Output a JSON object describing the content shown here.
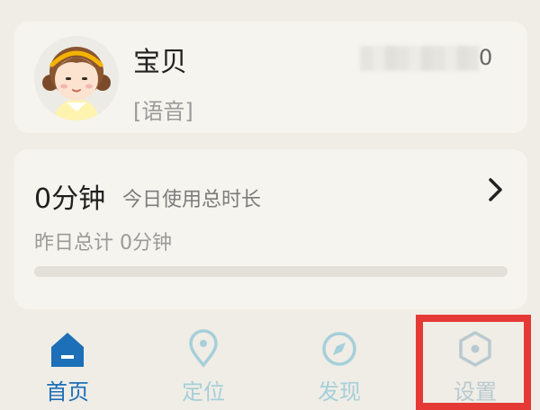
{
  "profile": {
    "name": "宝贝",
    "tag": "[语音]",
    "id_visible_tail": "0"
  },
  "usage": {
    "today_value": "0分钟",
    "today_label": "今日使用总时长",
    "yesterday": "昨日总计 0分钟",
    "arrow_icon": "chevron-right-icon"
  },
  "nav": {
    "items": [
      {
        "label": "首页",
        "icon": "home-icon",
        "active": true
      },
      {
        "label": "定位",
        "icon": "location-pin-icon",
        "active": false
      },
      {
        "label": "发现",
        "icon": "compass-icon",
        "active": false
      },
      {
        "label": "设置",
        "icon": "settings-hexagon-icon",
        "active": false
      }
    ]
  },
  "colors": {
    "accent": "#1d6fb8",
    "inactive": "#a6cfd9",
    "highlight": "#e53935",
    "background": "#efede6",
    "card": "#f6f4ee"
  }
}
